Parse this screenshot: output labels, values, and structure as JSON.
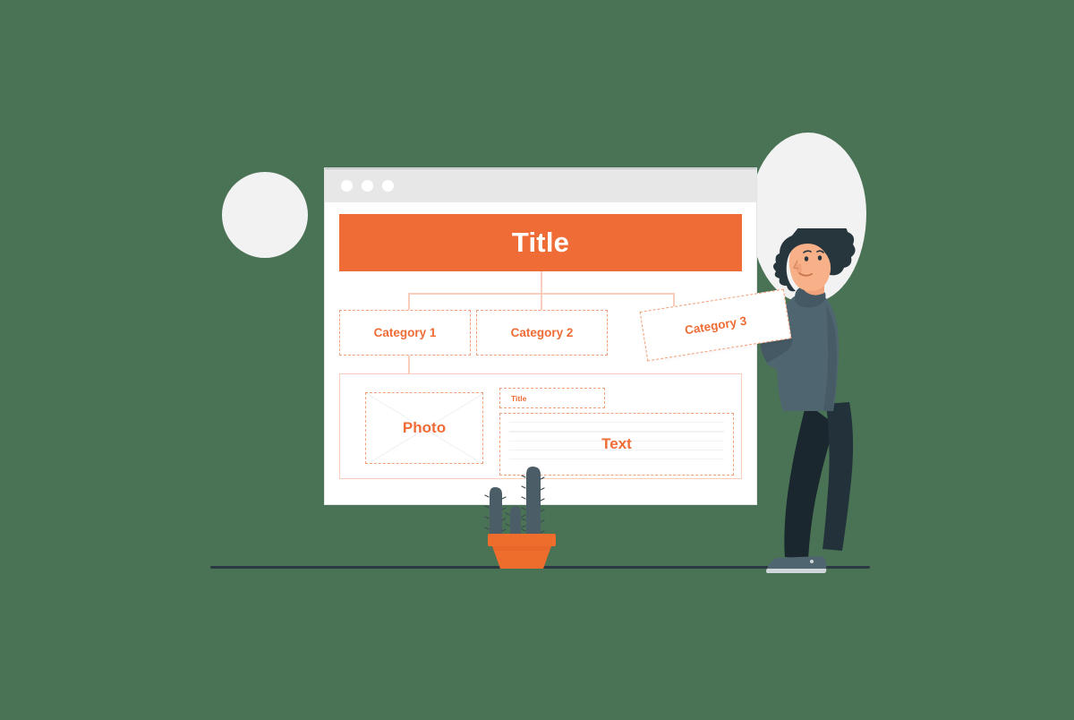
{
  "meta": {
    "background_color": "#4a7254",
    "accent_color": "#ef6c36",
    "accent_light_color": "#f3a07a",
    "connector_color": "#f8cdbb",
    "window_chrome_color": "#e7e7e7",
    "deco_shape_color": "#f2f2f2",
    "ground_color": "#2b3a42",
    "skin_color": "#f7b088",
    "hair_color": "#27353d",
    "shirt_color": "#4f6671",
    "pants_color": "#22313a",
    "cactus_color": "#4b5d66",
    "pot_color": "#ee6c2c"
  },
  "window": {
    "titlebar": {
      "dots": [
        "window-dot-1",
        "window-dot-2",
        "window-dot-3"
      ]
    },
    "title_band": {
      "label": "Title"
    },
    "categories": [
      {
        "label": "Category 1",
        "state": "placed"
      },
      {
        "label": "Category 2",
        "state": "placed"
      },
      {
        "label": "Category 3",
        "state": "dragging"
      }
    ],
    "content_panel": {
      "photo_placeholder": {
        "label": "Photo"
      },
      "small_title": {
        "label": "Title"
      },
      "text_placeholder": {
        "label": "Text",
        "line_count": 5
      }
    }
  },
  "decorations": {
    "circle": "decorative-circle",
    "blob": "decorative-blob",
    "ground": "ground-line"
  },
  "illustration": {
    "person": "person-holding-card",
    "plant": "potted-cactus"
  }
}
